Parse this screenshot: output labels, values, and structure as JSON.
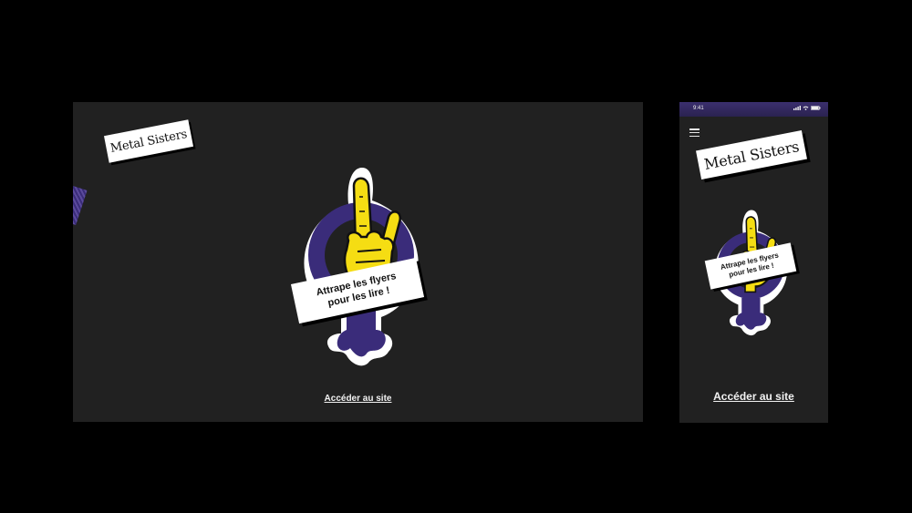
{
  "desktop": {
    "logo": "Metal Sisters",
    "hint_line1": "Attrape les flyers",
    "hint_line2": "pour les lire !",
    "link": "Accéder au site"
  },
  "mobile": {
    "time": "9:41",
    "logo": "Metal Sisters",
    "hint_line1": "Attrape les flyers",
    "hint_line2": "pour les lire !",
    "link": "Accéder au site"
  },
  "colors": {
    "background": "#000000",
    "screen": "#212121",
    "accent_purple": "#3a2c7a",
    "accent_yellow": "#f5dd13"
  },
  "icons": [
    "menu-icon",
    "signal-icon",
    "wifi-icon",
    "battery-icon",
    "rock-hand-icon"
  ]
}
